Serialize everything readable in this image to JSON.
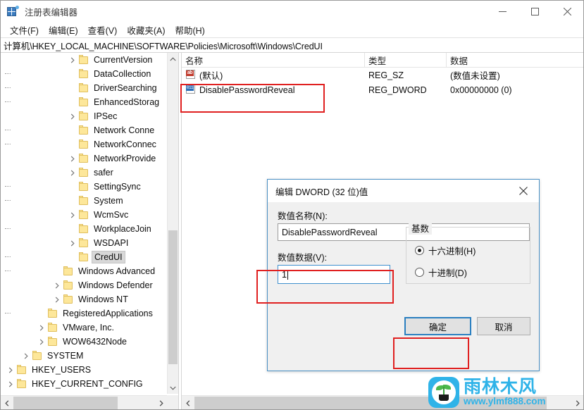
{
  "window": {
    "title": "注册表编辑器",
    "icon": "registry-icon",
    "caption_buttons": [
      {
        "name": "minimize",
        "glyph": "minimize-icon"
      },
      {
        "name": "maximize",
        "glyph": "maximize-icon"
      },
      {
        "name": "close",
        "glyph": "close-icon"
      }
    ]
  },
  "menu": {
    "items": [
      {
        "label": "文件(F)"
      },
      {
        "label": "编辑(E)"
      },
      {
        "label": "查看(V)"
      },
      {
        "label": "收藏夹(A)"
      },
      {
        "label": "帮助(H)"
      }
    ]
  },
  "address": {
    "path": "计算机\\HKEY_LOCAL_MACHINE\\SOFTWARE\\Policies\\Microsoft\\Windows\\CredUI"
  },
  "tree": {
    "items": [
      {
        "label": "CurrentVersion",
        "depth": 4,
        "expandable": true,
        "selected": false
      },
      {
        "label": "DataCollection",
        "depth": 4,
        "expandable": false,
        "selected": false
      },
      {
        "label": "DriverSearching",
        "depth": 4,
        "expandable": false,
        "selected": false
      },
      {
        "label": "EnhancedStorag",
        "depth": 4,
        "expandable": false,
        "selected": false
      },
      {
        "label": "IPSec",
        "depth": 4,
        "expandable": true,
        "selected": false
      },
      {
        "label": "Network Conne",
        "depth": 4,
        "expandable": false,
        "selected": false
      },
      {
        "label": "NetworkConnec",
        "depth": 4,
        "expandable": false,
        "selected": false
      },
      {
        "label": "NetworkProvide",
        "depth": 4,
        "expandable": true,
        "selected": false
      },
      {
        "label": "safer",
        "depth": 4,
        "expandable": true,
        "selected": false
      },
      {
        "label": "SettingSync",
        "depth": 4,
        "expandable": false,
        "selected": false
      },
      {
        "label": "System",
        "depth": 4,
        "expandable": false,
        "selected": false
      },
      {
        "label": "WcmSvc",
        "depth": 4,
        "expandable": true,
        "selected": false
      },
      {
        "label": "WorkplaceJoin",
        "depth": 4,
        "expandable": false,
        "selected": false
      },
      {
        "label": "WSDAPI",
        "depth": 4,
        "expandable": true,
        "selected": false
      },
      {
        "label": "CredUI",
        "depth": 4,
        "expandable": false,
        "selected": true
      },
      {
        "label": "Windows Advanced",
        "depth": 3,
        "expandable": false,
        "selected": false
      },
      {
        "label": "Windows Defender",
        "depth": 3,
        "expandable": true,
        "selected": false
      },
      {
        "label": "Windows NT",
        "depth": 3,
        "expandable": true,
        "selected": false
      },
      {
        "label": "RegisteredApplications",
        "depth": 2,
        "expandable": false,
        "selected": false
      },
      {
        "label": "VMware, Inc.",
        "depth": 2,
        "expandable": true,
        "selected": false
      },
      {
        "label": "WOW6432Node",
        "depth": 2,
        "expandable": true,
        "selected": false
      },
      {
        "label": "SYSTEM",
        "depth": 1,
        "expandable": true,
        "selected": false
      },
      {
        "label": "HKEY_USERS",
        "depth": 0,
        "expandable": true,
        "selected": false
      },
      {
        "label": "HKEY_CURRENT_CONFIG",
        "depth": 0,
        "expandable": true,
        "selected": false
      }
    ]
  },
  "list": {
    "columns": [
      {
        "label": "名称"
      },
      {
        "label": "类型"
      },
      {
        "label": "数据"
      }
    ],
    "rows": [
      {
        "icon": "string-value-icon",
        "icon_text": "ab",
        "name": "(默认)",
        "type": "REG_SZ",
        "data": "(数值未设置)"
      },
      {
        "icon": "dword-value-icon",
        "icon_text": "011",
        "name": "DisablePasswordReveal",
        "type": "REG_DWORD",
        "data": "0x00000000 (0)"
      }
    ]
  },
  "dialog": {
    "title": "编辑 DWORD (32 位)值",
    "close_icon": "close-icon",
    "value_name_label": "数值名称(N):",
    "value_name": "DisablePasswordReveal",
    "value_data_label": "数值数据(V):",
    "value_data": "1",
    "base_group_label": "基数",
    "base_options": [
      {
        "label": "十六进制(H)",
        "checked": true
      },
      {
        "label": "十进制(D)",
        "checked": false
      }
    ],
    "ok_label": "确定",
    "cancel_label": "取消"
  },
  "watermark": {
    "brand": "雨林木风",
    "url": "www.ylmf888.com"
  },
  "colors": {
    "annotation_red": "#e02020",
    "accent_blue": "#2a7fc0",
    "folder_yellow": "#fde79a",
    "watermark_cyan": "#2fb3e8"
  }
}
